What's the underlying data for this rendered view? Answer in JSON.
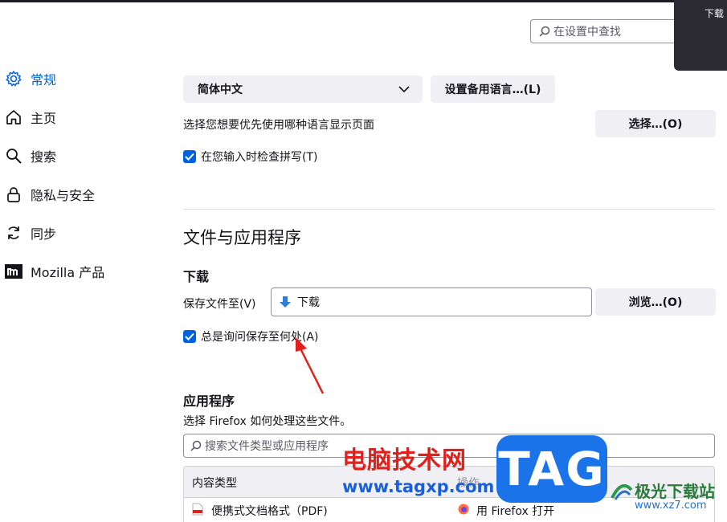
{
  "search": {
    "placeholder": "在设置中查找"
  },
  "download_popup": {
    "label": "下载"
  },
  "sidebar": {
    "items": [
      {
        "label": "常规",
        "icon": "gear-icon",
        "active": true
      },
      {
        "label": "主页",
        "icon": "home-icon"
      },
      {
        "label": "搜索",
        "icon": "search-icon"
      },
      {
        "label": "隐私与安全",
        "icon": "lock-icon"
      },
      {
        "label": "同步",
        "icon": "sync-icon"
      },
      {
        "label": "Mozilla 产品",
        "icon": "mozilla-icon"
      }
    ]
  },
  "language": {
    "selected": "简体中文",
    "alt_button": "设置备用语言…(L)",
    "prompt": "选择您想要优先使用哪种语言显示页面",
    "choose_button": "选择…(O)",
    "spellcheck_label": "在您输入时检查拼写(T)",
    "spellcheck_checked": true
  },
  "files": {
    "section_title": "文件与应用程序",
    "download_title": "下载",
    "save_to_label": "保存文件至(V)",
    "save_to_value": "下载",
    "browse_button": "浏览…(O)",
    "always_ask_label": "总是询问保存至何处(A)",
    "always_ask_checked": true
  },
  "apps": {
    "title": "应用程序",
    "description": "选择 Firefox 如何处理这些文件。",
    "search_placeholder": "搜索文件类型或应用程序",
    "columns": [
      "内容类型",
      "操作"
    ],
    "rows": [
      {
        "type": "便携式文档格式（PDF)",
        "action": "用 Firefox 打开"
      }
    ]
  },
  "watermarks": {
    "site_name": "电脑技术网",
    "site_url": "www.tagxp.com",
    "tag": "TAG",
    "right_name": "极光下载站",
    "right_url": "www.xz7.com"
  },
  "colors": {
    "accent": "#0061e0",
    "button_bg": "#f0f0f4",
    "annotation_arrow": "#e0201c"
  }
}
